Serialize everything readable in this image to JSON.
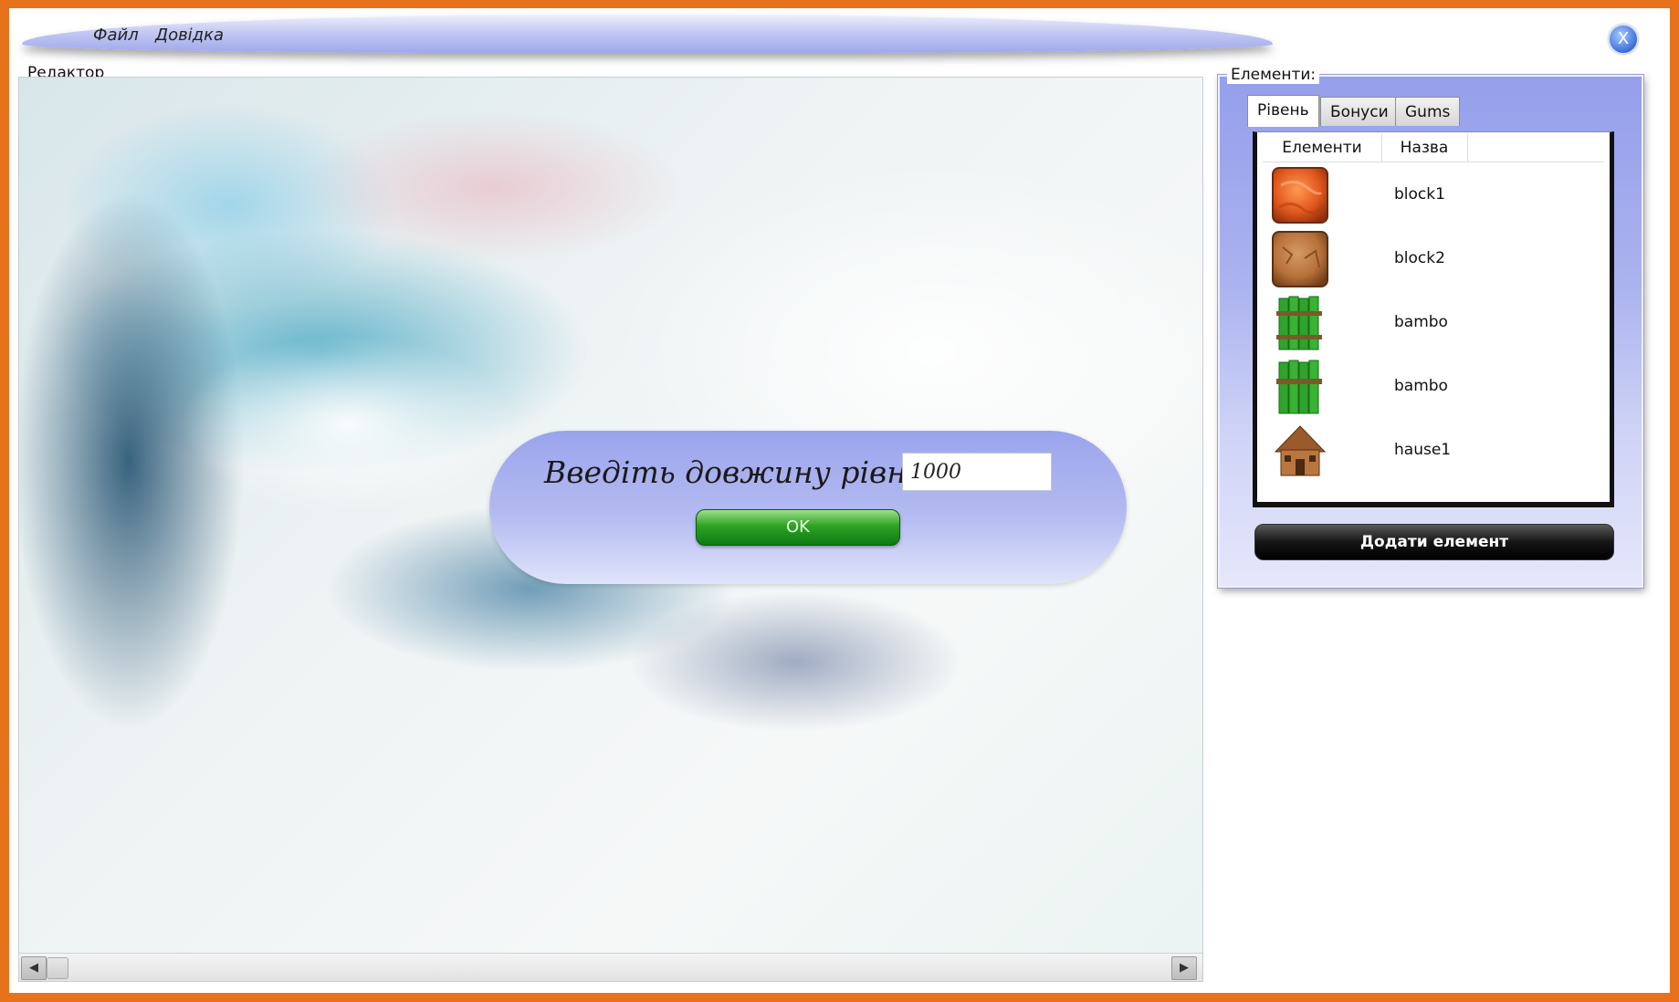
{
  "menu": {
    "file": "Файл",
    "help": "Довідка"
  },
  "window": {
    "close_label": "X"
  },
  "editor": {
    "label": "Редактор"
  },
  "scrollbar": {
    "left_arrow": "◀",
    "right_arrow": "▶"
  },
  "dialog": {
    "prompt": "Введіть довжину рівня:",
    "input_value": "1000",
    "ok_label": "OK"
  },
  "panel": {
    "title": "Елементи:",
    "tabs": [
      "Рівень",
      "Бонуси",
      "Gums"
    ],
    "active_tab": "Рівень",
    "columns": [
      "Елементи",
      "Назва"
    ],
    "items": [
      {
        "name": "block1",
        "icon": "orange-block-icon"
      },
      {
        "name": "block2",
        "icon": "brown-block-icon"
      },
      {
        "name": "bambo",
        "icon": "bamboo-icon"
      },
      {
        "name": "bambo",
        "icon": "bamboo-icon"
      },
      {
        "name": "hause1",
        "icon": "house-icon"
      }
    ],
    "add_button": "Додати елемент"
  },
  "colors": {
    "frame": "#e8711c",
    "panel": "#aab2ef",
    "ok_button": "#2fa325",
    "add_button": "#151515"
  }
}
